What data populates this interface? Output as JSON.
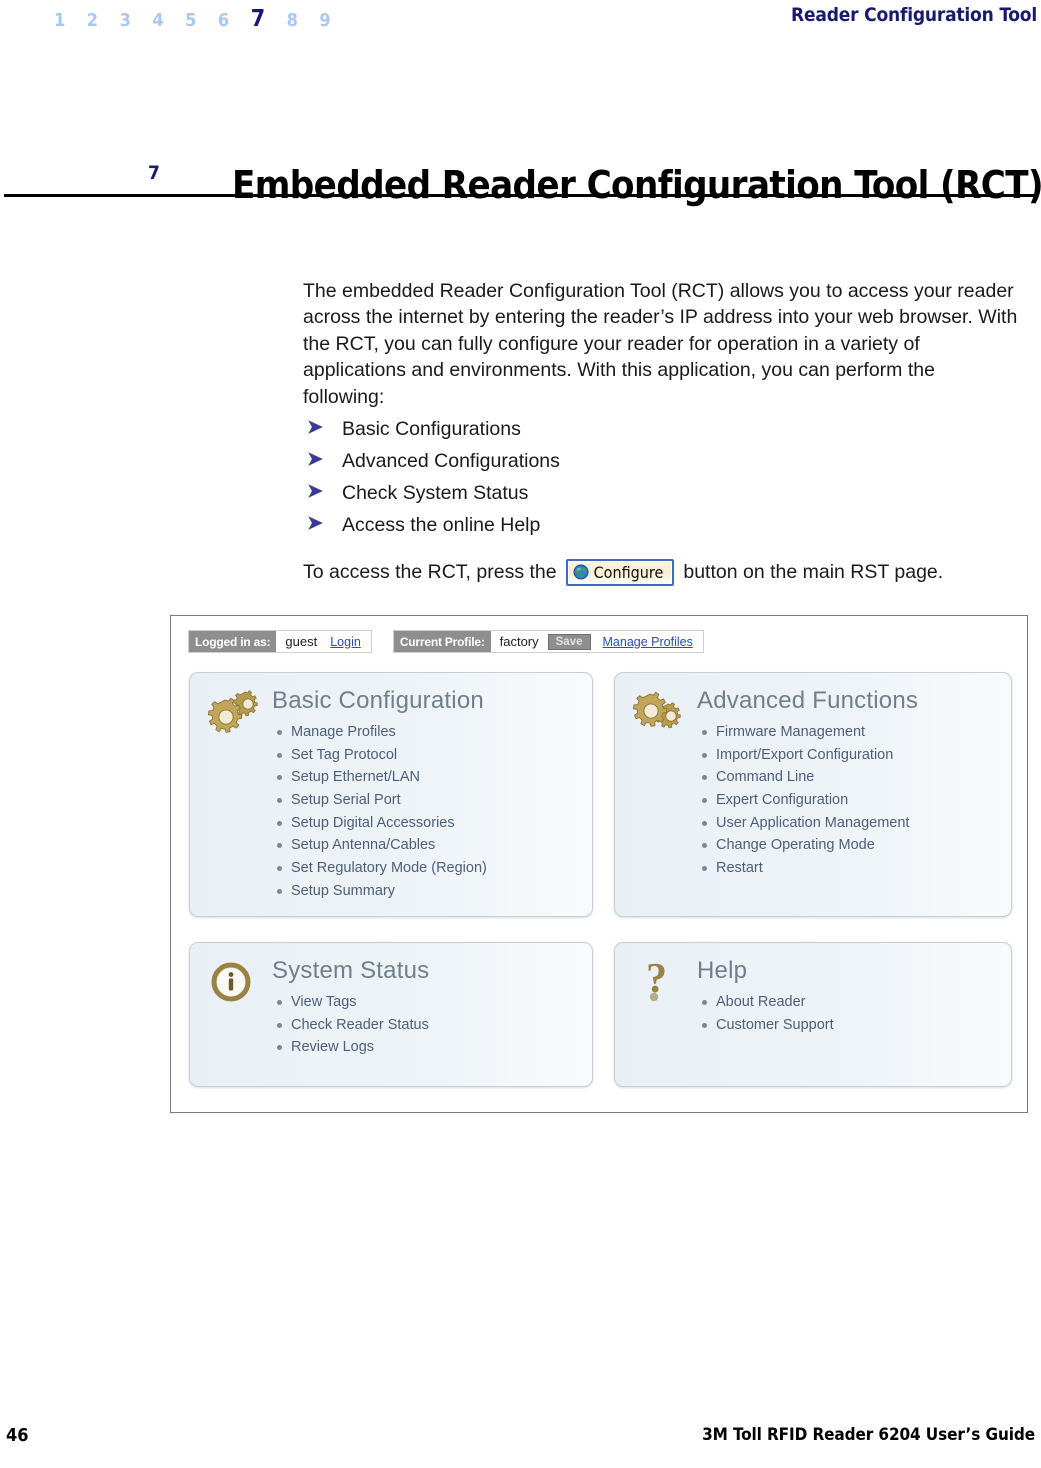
{
  "header": {
    "chapter_numbers": [
      "1",
      "2",
      "3",
      "4",
      "5",
      "6",
      "7",
      "8",
      "9"
    ],
    "current_chapter": "7",
    "title": "Reader Configuration Tool"
  },
  "title_block": {
    "chapter_number": "7",
    "title": "Embedded Reader Configuration Tool (RCT)"
  },
  "body": {
    "intro": "The embedded Reader Configuration Tool (RCT) allows you to access your reader across the internet by entering the reader’s IP address into your web browser. With the RCT, you can fully configure your reader for operation in a variety of applications and environments. With this application, you can perform the following:",
    "features": [
      "Basic Configurations",
      "Advanced Configurations",
      "Check System Status",
      "Access the online Help"
    ],
    "access_text_before": "To access the RCT, press the",
    "configure_button_label": "Configure",
    "access_text_after": "button on the main RST page."
  },
  "screenshot": {
    "status_bar": {
      "login_label": "Logged in as:",
      "login_value": "guest",
      "login_link": "Login",
      "profile_label": "Current Profile:",
      "profile_value": "factory",
      "save_button": "Save",
      "manage_link": "Manage Profiles"
    },
    "panels": [
      {
        "title": "Basic Configuration",
        "items": [
          "Manage Profiles",
          "Set Tag Protocol",
          "Setup Ethernet/LAN",
          "Setup Serial Port",
          "Setup Digital Accessories",
          "Setup Antenna/Cables",
          "Set Regulatory Mode (Region)",
          "Setup Summary"
        ]
      },
      {
        "title": "Advanced Functions",
        "items": [
          "Firmware Management",
          "Import/Export Configuration",
          "Command Line",
          "Expert Configuration",
          "User Application Management",
          "Change Operating Mode",
          "Restart"
        ]
      },
      {
        "title": "System Status",
        "items": [
          "View Tags",
          "Check Reader Status",
          "Review Logs"
        ]
      },
      {
        "title": "Help",
        "items": [
          "About Reader",
          "Customer Support"
        ]
      }
    ]
  },
  "footer": {
    "page_number": "46",
    "guide_title": "3M Toll RFID Reader 6204 User’s Guide"
  },
  "colors": {
    "header_navy": "#191970",
    "chapter_inactive": "#a8c8f0",
    "arrow_bullet": "#3b3b96",
    "panel_title": "#6f7f8c",
    "panel_item": "#4d5f78",
    "link_blue": "#2a4fa8",
    "gear_gold": "#b59a50",
    "button_border": "#4169c4"
  }
}
